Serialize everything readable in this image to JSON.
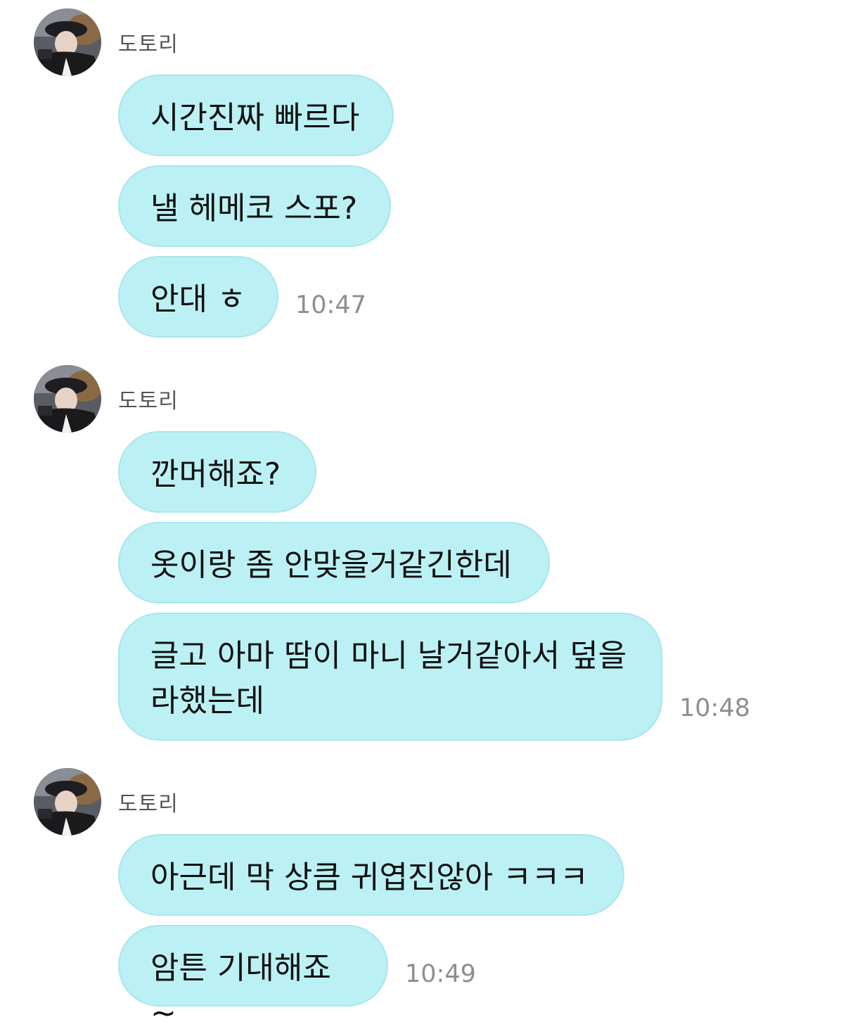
{
  "groups": [
    {
      "sender": "도토리",
      "messages": [
        "시간진짜 빠르다",
        "낼 헤메코 스포?",
        "안대 ㅎ"
      ],
      "time": "10:47"
    },
    {
      "sender": "도토리",
      "messages": [
        "깐머해죠?",
        "옷이랑 좀 안맞을거같긴한데",
        "글고 아마 땀이 마니 날거같아서 덮을\n라했는데"
      ],
      "time": "10:48"
    },
    {
      "sender": "도토리",
      "messages": [
        "아근데 막 상큼 귀엽진않아 ㅋㅋㅋ",
        "암튼 기대해죠~"
      ],
      "time": "10:49"
    }
  ],
  "colors": {
    "bubble": "#bbf1f4",
    "bubble_border": "#a8e6ec",
    "time": "#8e8e8e",
    "sender": "#555555"
  },
  "icons": {
    "avatar": "profile-photo"
  }
}
